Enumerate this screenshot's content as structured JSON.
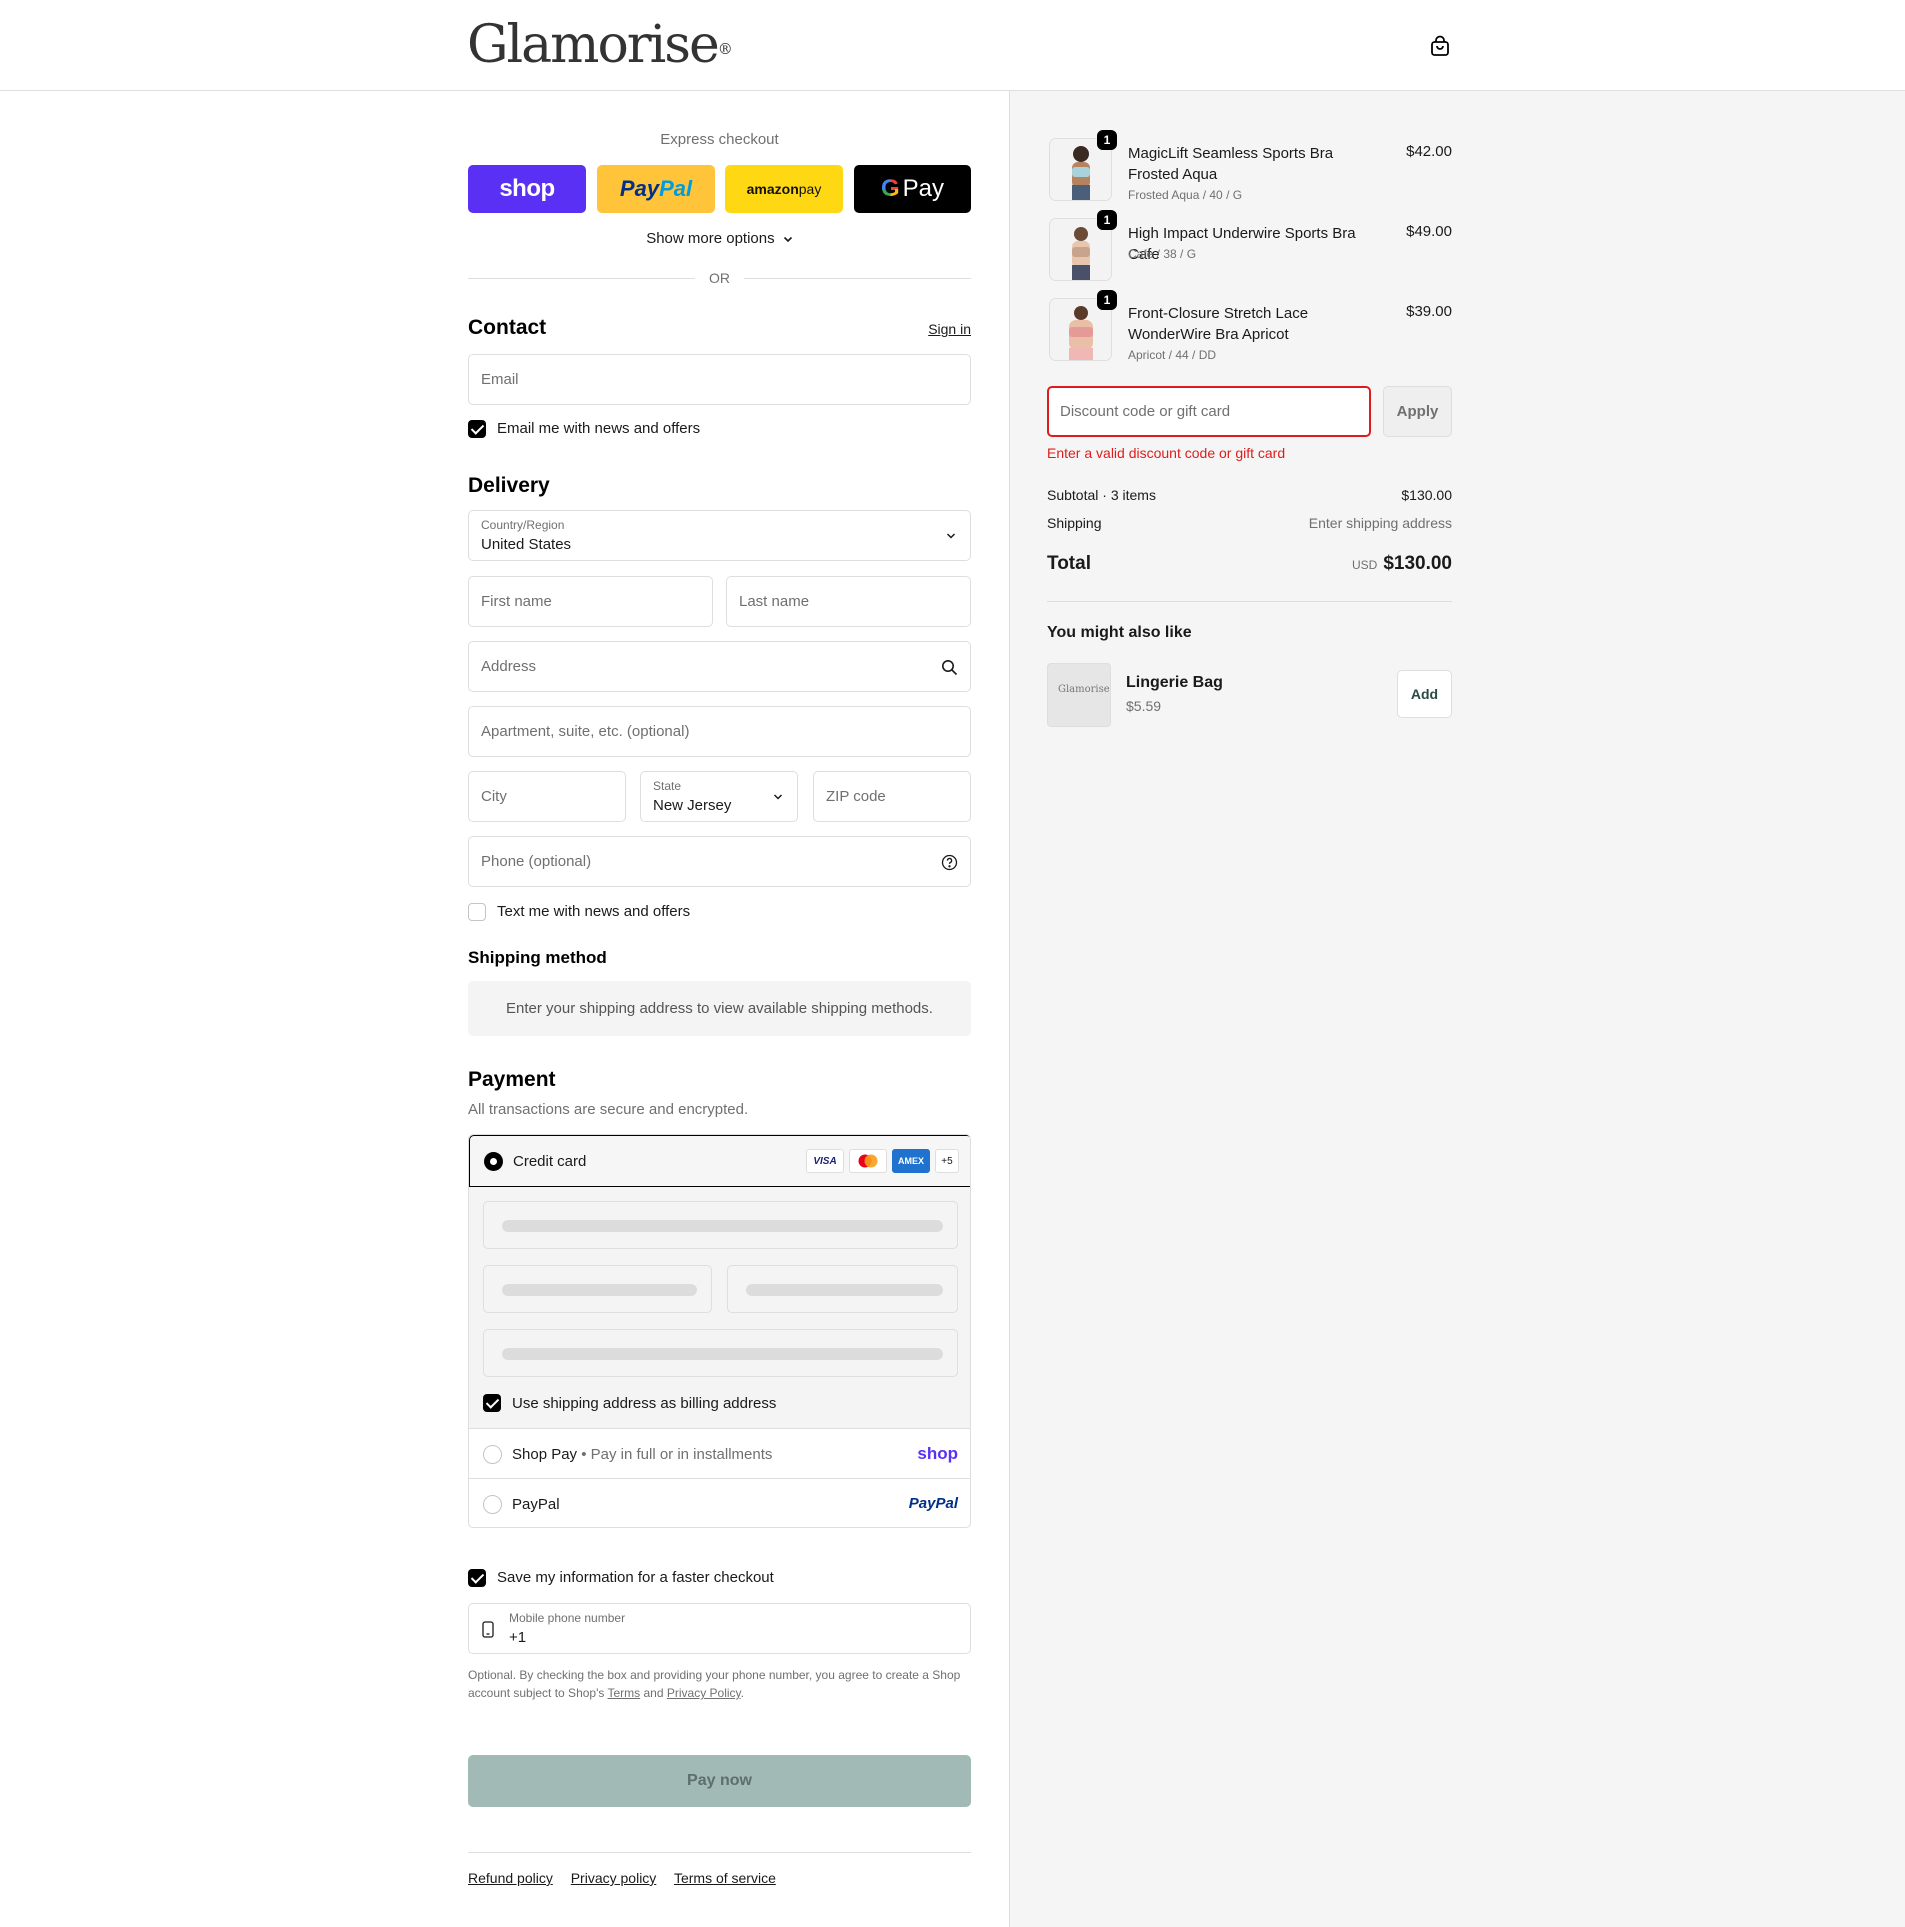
{
  "header": {
    "logo": "Glamorise",
    "logo_mark": "®",
    "cart_icon": "shopping-bag-icon"
  },
  "express": {
    "title": "Express checkout",
    "shop_label": "shop",
    "paypal_pay": "Pay",
    "paypal_pal": "Pal",
    "amazon_label_bold": "amazon",
    "amazon_label": " pay",
    "gpay_g": "G",
    "gpay_label": "Pay",
    "show_more": "Show more options",
    "or": "OR"
  },
  "contact": {
    "title": "Contact",
    "sign_in": "Sign in",
    "email_placeholder": "Email",
    "news_label": "Email me with news and offers",
    "news_checked": true
  },
  "delivery": {
    "title": "Delivery",
    "country_label": "Country/Region",
    "country_value": "United States",
    "first_name": "First name",
    "last_name": "Last name",
    "address": "Address",
    "apartment": "Apartment, suite, etc. (optional)",
    "city": "City",
    "state_label": "State",
    "state_value": "New Jersey",
    "zip": "ZIP code",
    "phone": "Phone (optional)",
    "text_label": "Text me with news and offers",
    "text_checked": false
  },
  "shipping": {
    "title": "Shipping method",
    "message": "Enter your shipping address to view available shipping methods."
  },
  "payment": {
    "title": "Payment",
    "note": "All transactions are secure and encrypted.",
    "credit_card": "Credit card",
    "card_logos": [
      "VISA",
      "",
      "AMEX",
      "+5"
    ],
    "billing_label": "Use shipping address as billing address",
    "shop_pay": "Shop Pay",
    "shop_pay_sub": "Pay in full or in installments",
    "shop_pay_logo": "shop",
    "paypal": "PayPal",
    "paypal_logo": "PayPal"
  },
  "save": {
    "label": "Save my information for a faster checkout",
    "phone_label": "Mobile phone number",
    "phone_value": "+1",
    "disclaimer_1": "Optional. By checking the box and providing your phone number, you agree to create a Shop account subject to Shop's ",
    "terms": "Terms",
    "and": " and ",
    "privacy": "Privacy Policy",
    "period": "."
  },
  "pay_now": "Pay now",
  "footer": {
    "links": [
      "Refund policy",
      "Privacy policy",
      "Terms of service"
    ]
  },
  "summary": {
    "items": [
      {
        "name": "MagicLift Seamless Sports Bra Frosted Aqua",
        "variant": "Frosted Aqua / 40 / G",
        "price": "$42.00",
        "qty": "1",
        "color": "#a8d3dd"
      },
      {
        "name": "High Impact Underwire Sports Bra Cafe",
        "variant": "Cafe / 38 / G",
        "price": "$49.00",
        "qty": "1",
        "color": "#c9a48c"
      },
      {
        "name": "Front-Closure Stretch Lace WonderWire Bra Apricot",
        "variant": "Apricot / 44 / DD",
        "price": "$39.00",
        "qty": "1",
        "color": "#e59a97"
      }
    ],
    "discount_placeholder": "Discount code or gift card",
    "apply": "Apply",
    "discount_error": "Enter a valid discount code or gift card",
    "subtotal_label": "Subtotal · 3 items",
    "subtotal": "$130.00",
    "shipping_label": "Shipping",
    "shipping_value": "Enter shipping address",
    "total_label": "Total",
    "currency": "USD",
    "total": "$130.00",
    "recommend_title": "You might also like",
    "rec_name": "Lingerie Bag",
    "rec_price": "$5.59",
    "rec_logo": "Glamorise",
    "add": "Add"
  }
}
